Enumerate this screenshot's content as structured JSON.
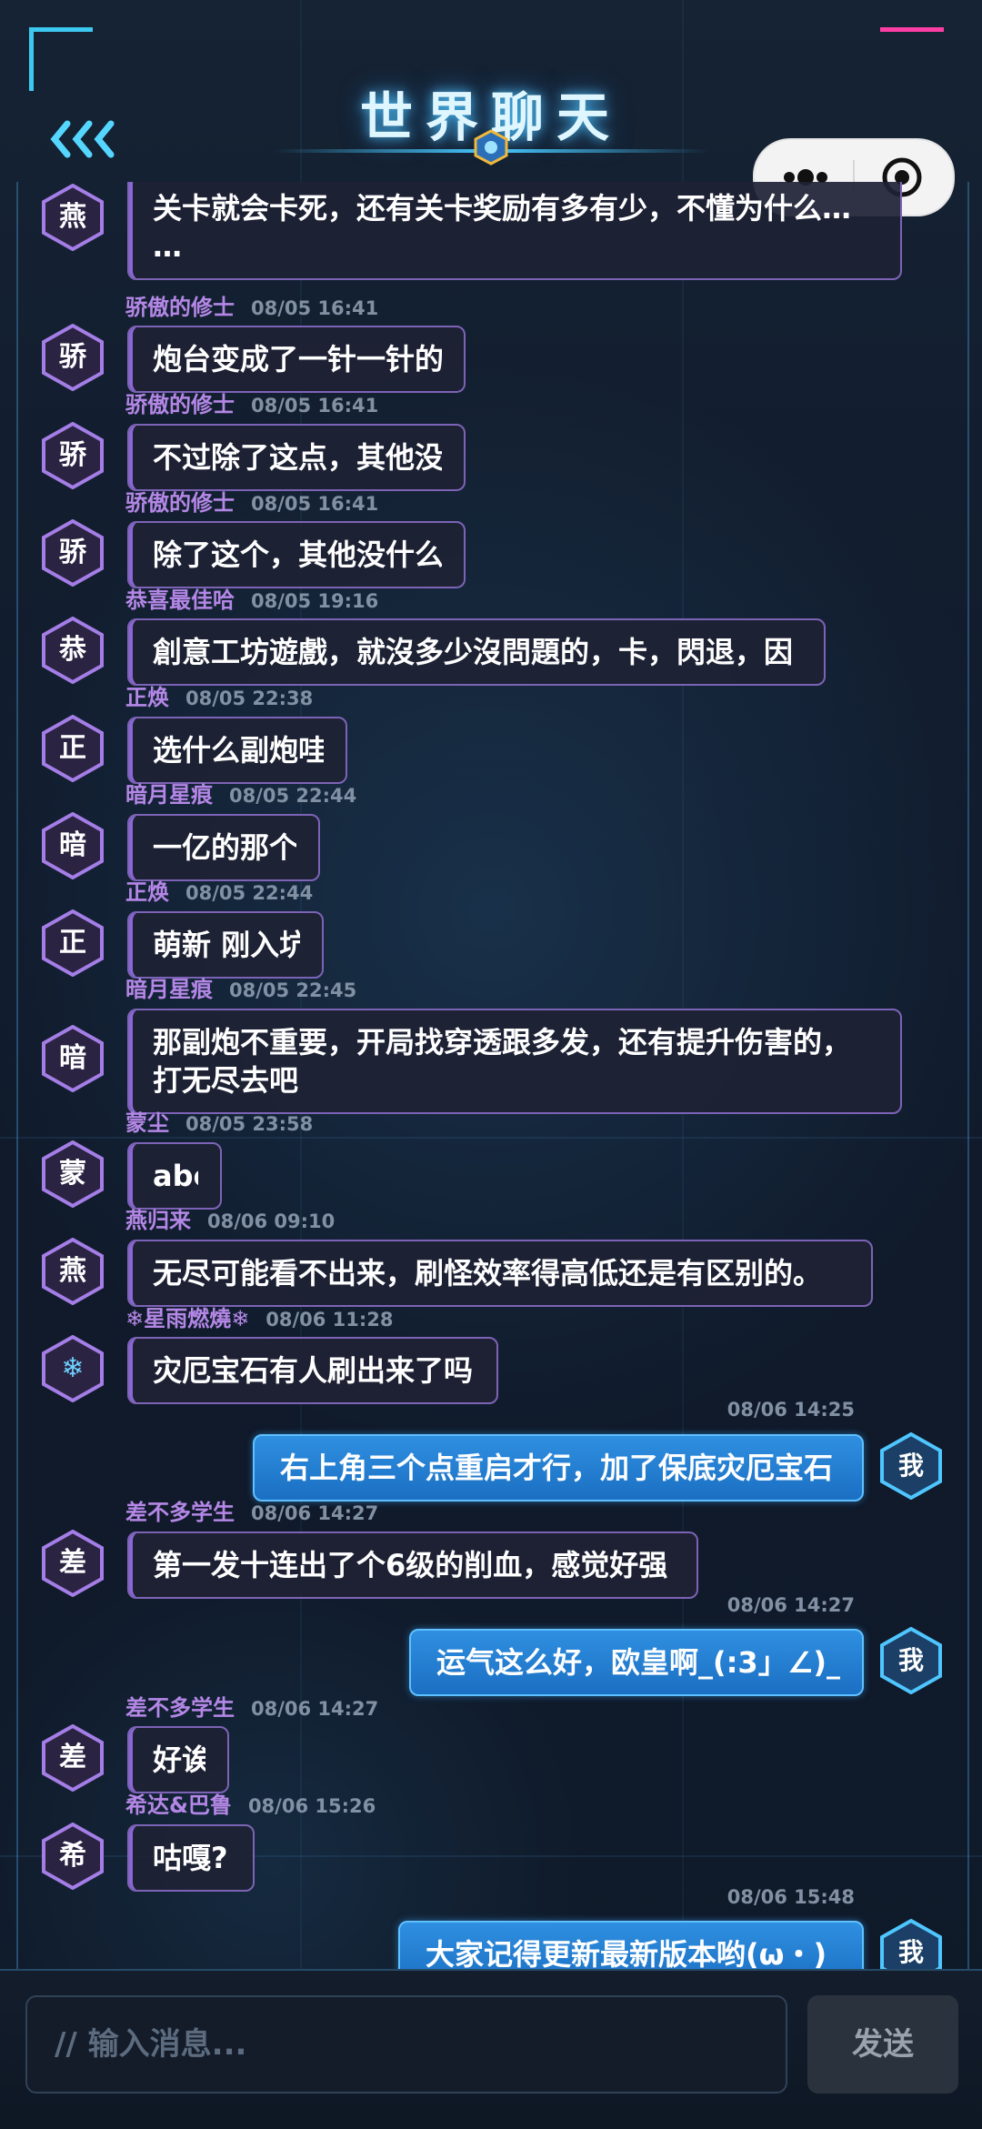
{
  "header": {
    "title": "世界聊天",
    "back_icon": "triple-chevron-left-icon",
    "capsule": {
      "more_icon": "more-dots-icon",
      "close_icon": "target-circle-icon"
    }
  },
  "colors": {
    "nick": "#b487e6",
    "self_bubble": "#1f78cc",
    "other_border": "#7d63b6",
    "title_glow": "#47c8ff"
  },
  "messages": [
    {
      "id": 0,
      "self": false,
      "avatar": "燕",
      "nick": "",
      "time": "",
      "lines": [
        "关卡就会卡死，还有关卡奖励有多有少，不懂为什么…",
        "…"
      ]
    },
    {
      "id": 1,
      "self": false,
      "avatar": "骄",
      "nick": "骄傲的修士",
      "time": "08/05 16:41",
      "lines": [
        "炮台变成了一针一针的"
      ]
    },
    {
      "id": 2,
      "self": false,
      "avatar": "骄",
      "nick": "骄傲的修士",
      "time": "08/05 16:41",
      "lines": [
        "不过除了这点，其他没"
      ]
    },
    {
      "id": 3,
      "self": false,
      "avatar": "骄",
      "nick": "骄傲的修士",
      "time": "08/05 16:41",
      "lines": [
        "除了这个，其他没什么"
      ]
    },
    {
      "id": 4,
      "self": false,
      "avatar": "恭",
      "nick": "恭喜最佳哈",
      "time": "08/05 19:16",
      "lines": [
        "創意工坊遊戲，就沒多少沒問題的，卡，閃退，因"
      ]
    },
    {
      "id": 5,
      "self": false,
      "avatar": "正",
      "nick": "正焕",
      "time": "08/05 22:38",
      "lines": [
        "选什么副炮哇"
      ]
    },
    {
      "id": 6,
      "self": false,
      "avatar": "暗",
      "nick": "暗月星痕",
      "time": "08/05 22:44",
      "lines": [
        "一亿的那个"
      ]
    },
    {
      "id": 7,
      "self": false,
      "avatar": "正",
      "nick": "正焕",
      "time": "08/05 22:44",
      "lines": [
        "萌新 刚入坑"
      ]
    },
    {
      "id": 8,
      "self": false,
      "avatar": "暗",
      "nick": "暗月星痕",
      "time": "08/05 22:45",
      "lines": [
        "那副炮不重要，开局找穿透跟多发，还有提升伤害的，",
        "打无尽去吧"
      ]
    },
    {
      "id": 9,
      "self": false,
      "avatar": "蒙",
      "nick": "蒙尘",
      "time": "08/05 23:58",
      "lines": [
        "abc"
      ]
    },
    {
      "id": 10,
      "self": false,
      "avatar": "燕",
      "nick": "燕归来",
      "time": "08/06 09:10",
      "lines": [
        "无尽可能看不出来，刷怪效率得高低还是有区别的。"
      ]
    },
    {
      "id": 11,
      "self": false,
      "avatar": "❄",
      "nick": "❄星雨燃燒❄",
      "time": "08/06 11:28",
      "lines": [
        "灾厄宝石有人刷出来了吗"
      ]
    },
    {
      "id": 12,
      "self": true,
      "avatar": "我",
      "nick": "",
      "time": "08/06 14:25",
      "lines": [
        "右上角三个点重启才行，加了保底灾厄宝石"
      ]
    },
    {
      "id": 13,
      "self": false,
      "avatar": "差",
      "nick": "差不多学生",
      "time": "08/06 14:27",
      "lines": [
        "第一发十连出了个6级的削血，感觉好强"
      ]
    },
    {
      "id": 14,
      "self": true,
      "avatar": "我",
      "nick": "",
      "time": "08/06 14:27",
      "lines": [
        "运气这么好，欧皇啊_(:3」∠)_"
      ]
    },
    {
      "id": 15,
      "self": false,
      "avatar": "差",
      "nick": "差不多学生",
      "time": "08/06 14:27",
      "lines": [
        "好诶"
      ]
    },
    {
      "id": 16,
      "self": false,
      "avatar": "希",
      "nick": "希达&巴鲁",
      "time": "08/06 15:26",
      "lines": [
        "咕嘎?"
      ]
    },
    {
      "id": 17,
      "self": true,
      "avatar": "我",
      "nick": "",
      "time": "08/06 15:48",
      "lines": [
        "大家记得更新最新版本哟(ω・)"
      ]
    }
  ],
  "input": {
    "placeholder": "// 输入消息...",
    "value": "",
    "send_label": "发送"
  }
}
